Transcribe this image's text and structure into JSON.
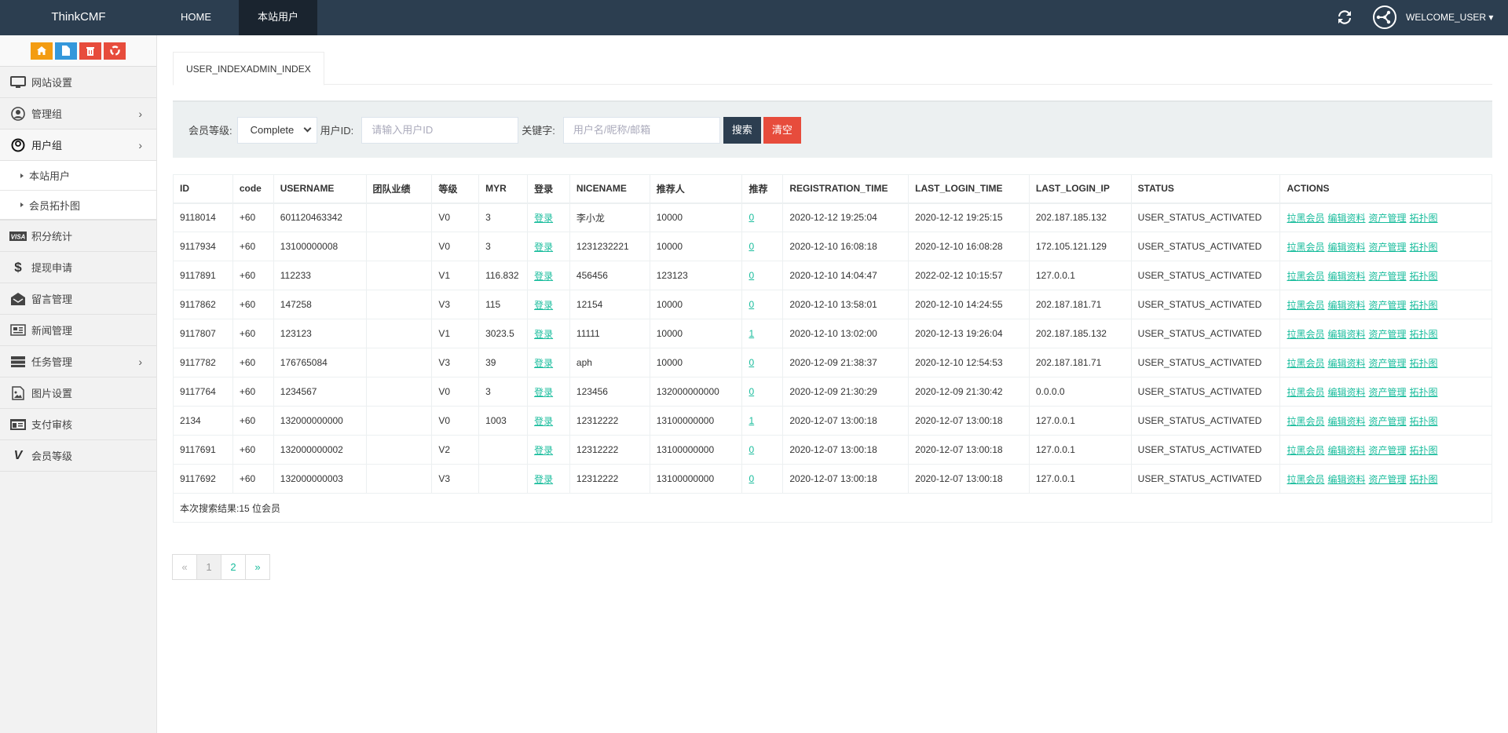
{
  "navbar": {
    "brand": "ThinkCMF",
    "items": [
      {
        "label": "HOME"
      },
      {
        "label": "本站用户"
      }
    ],
    "user": "WELCOME_USER",
    "colors": {
      "bg": "#2c3e50",
      "active": "#1a242f"
    }
  },
  "sidebar": {
    "quick_buttons": [
      {
        "icon": "home-icon",
        "color": "#f39c12"
      },
      {
        "icon": "file-icon",
        "color": "#3498db"
      },
      {
        "icon": "trash-icon",
        "color": "#e74c3c"
      },
      {
        "icon": "recycle-icon",
        "color": "#e74c3c"
      }
    ],
    "items": [
      {
        "label": "网站设置",
        "icon": "monitor-icon"
      },
      {
        "label": "管理组",
        "icon": "user-circle-icon",
        "has_children": true
      },
      {
        "label": "用户组",
        "icon": "user-icon",
        "has_children": true,
        "active": true
      },
      {
        "label": "积分统计",
        "icon": "visa-icon"
      },
      {
        "label": "提现申请",
        "icon": "dollar-icon"
      },
      {
        "label": "留言管理",
        "icon": "envelope-open-icon"
      },
      {
        "label": "新闻管理",
        "icon": "newspaper-icon"
      },
      {
        "label": "任务管理",
        "icon": "server-icon",
        "has_children": true
      },
      {
        "label": "图片设置",
        "icon": "image-file-icon"
      },
      {
        "label": "支付审核",
        "icon": "id-card-icon"
      },
      {
        "label": "会员等级",
        "icon": "vine-icon"
      }
    ],
    "subitems": [
      {
        "label": "本站用户"
      },
      {
        "label": "会员拓扑图"
      }
    ]
  },
  "tab": {
    "label": "USER_INDEXADMIN_INDEX"
  },
  "filter": {
    "level_label": "会员等级:",
    "level_value": "Complete",
    "userid_label": "用户ID:",
    "userid_placeholder": "请输入用户ID",
    "userid_value": "",
    "keyword_label": "关键字:",
    "keyword_placeholder": "用户名/昵称/邮箱",
    "keyword_value": "",
    "search_label": "搜索",
    "clear_label": "清空"
  },
  "table": {
    "columns": [
      "ID",
      "code",
      "USERNAME",
      "团队业绩",
      "等级",
      "MYR",
      "登录",
      "NICENAME",
      "推荐人",
      "推荐",
      "REGISTRATION_TIME",
      "LAST_LOGIN_TIME",
      "LAST_LOGIN_IP",
      "STATUS",
      "ACTIONS"
    ],
    "login_label": "登录",
    "actions": [
      "拉黑会员",
      "编辑资料",
      "资产管理",
      "拓扑图"
    ],
    "rows": [
      {
        "id": "9118014",
        "code": "+60",
        "username": "601120463342",
        "team": "",
        "level": "V0",
        "myr": "3",
        "nicename": "李小龙",
        "referrer": "10000",
        "referrals": "0",
        "reg_time": "2020-12-12 19:25:04",
        "last_login": "2020-12-12 19:25:15",
        "ip": "202.187.185.132",
        "status": "USER_STATUS_ACTIVATED"
      },
      {
        "id": "9117934",
        "code": "+60",
        "username": "13100000008",
        "team": "",
        "level": "V0",
        "myr": "3",
        "nicename": "1231232221",
        "referrer": "10000",
        "referrals": "0",
        "reg_time": "2020-12-10 16:08:18",
        "last_login": "2020-12-10 16:08:28",
        "ip": "172.105.121.129",
        "status": "USER_STATUS_ACTIVATED"
      },
      {
        "id": "9117891",
        "code": "+60",
        "username": "112233",
        "team": "",
        "level": "V1",
        "myr": "116.832",
        "nicename": "456456",
        "referrer": "123123",
        "referrals": "0",
        "reg_time": "2020-12-10 14:04:47",
        "last_login": "2022-02-12 10:15:57",
        "ip": "127.0.0.1",
        "status": "USER_STATUS_ACTIVATED"
      },
      {
        "id": "9117862",
        "code": "+60",
        "username": "147258",
        "team": "",
        "level": "V3",
        "myr": "115",
        "nicename": "12154",
        "referrer": "10000",
        "referrals": "0",
        "reg_time": "2020-12-10 13:58:01",
        "last_login": "2020-12-10 14:24:55",
        "ip": "202.187.181.71",
        "status": "USER_STATUS_ACTIVATED"
      },
      {
        "id": "9117807",
        "code": "+60",
        "username": "123123",
        "team": "",
        "level": "V1",
        "myr": "3023.5",
        "nicename": "11111",
        "referrer": "10000",
        "referrals": "1",
        "reg_time": "2020-12-10 13:02:00",
        "last_login": "2020-12-13 19:26:04",
        "ip": "202.187.185.132",
        "status": "USER_STATUS_ACTIVATED"
      },
      {
        "id": "9117782",
        "code": "+60",
        "username": "176765084",
        "team": "",
        "level": "V3",
        "myr": "39",
        "nicename": "aph",
        "referrer": "10000",
        "referrals": "0",
        "reg_time": "2020-12-09 21:38:37",
        "last_login": "2020-12-10 12:54:53",
        "ip": "202.187.181.71",
        "status": "USER_STATUS_ACTIVATED"
      },
      {
        "id": "9117764",
        "code": "+60",
        "username": "1234567",
        "team": "",
        "level": "V0",
        "myr": "3",
        "nicename": "123456",
        "referrer": "132000000000",
        "referrals": "0",
        "reg_time": "2020-12-09 21:30:29",
        "last_login": "2020-12-09 21:30:42",
        "ip": "0.0.0.0",
        "status": "USER_STATUS_ACTIVATED"
      },
      {
        "id": "2134",
        "code": "+60",
        "username": "132000000000",
        "team": "",
        "level": "V0",
        "myr": "1003",
        "nicename": "12312222",
        "referrer": "13100000000",
        "referrals": "1",
        "reg_time": "2020-12-07 13:00:18",
        "last_login": "2020-12-07 13:00:18",
        "ip": "127.0.0.1",
        "status": "USER_STATUS_ACTIVATED"
      },
      {
        "id": "9117691",
        "code": "+60",
        "username": "132000000002",
        "team": "",
        "level": "V2",
        "myr": "",
        "nicename": "12312222",
        "referrer": "13100000000",
        "referrals": "0",
        "reg_time": "2020-12-07 13:00:18",
        "last_login": "2020-12-07 13:00:18",
        "ip": "127.0.0.1",
        "status": "USER_STATUS_ACTIVATED"
      },
      {
        "id": "9117692",
        "code": "+60",
        "username": "132000000003",
        "team": "",
        "level": "V3",
        "myr": "",
        "nicename": "12312222",
        "referrer": "13100000000",
        "referrals": "0",
        "reg_time": "2020-12-07 13:00:18",
        "last_login": "2020-12-07 13:00:18",
        "ip": "127.0.0.1",
        "status": "USER_STATUS_ACTIVATED"
      }
    ],
    "summary": "本次搜索结果:15 位会员"
  },
  "pagination": {
    "prev": "«",
    "pages": [
      "1",
      "2"
    ],
    "current": "1",
    "next": "»"
  },
  "colors": {
    "link": "#18bc9c",
    "danger": "#e74c3c",
    "primary": "#2c3e50"
  }
}
